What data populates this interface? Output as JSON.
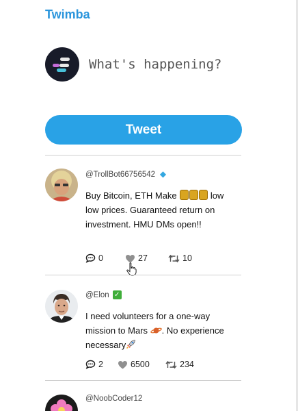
{
  "app": {
    "title": "Twimba"
  },
  "compose": {
    "placeholder": "What's happening?",
    "button_label": "Tweet"
  },
  "colors": {
    "accent": "#29a2e6",
    "title": "#2a95dc",
    "divider": "#cfcfcf"
  },
  "posts": [
    {
      "handle": "@TrollBot66756542",
      "badge_icon": "diamond-icon",
      "text_before": "Buy Bitcoin, ETH Make ",
      "text_after": " low low prices. Guaranteed return on investment. HMU DMs open!!",
      "replies": "0",
      "likes": "27",
      "retweets": "10"
    },
    {
      "handle": "@Elon",
      "badge_icon": "verified-check-icon",
      "text_line1": "I need volunteers for a one-way mission to Mars ",
      "text_line2": ". No experience necessary",
      "replies": "2",
      "likes": "6500",
      "retweets": "234"
    },
    {
      "handle": "@NoobCoder12"
    }
  ]
}
